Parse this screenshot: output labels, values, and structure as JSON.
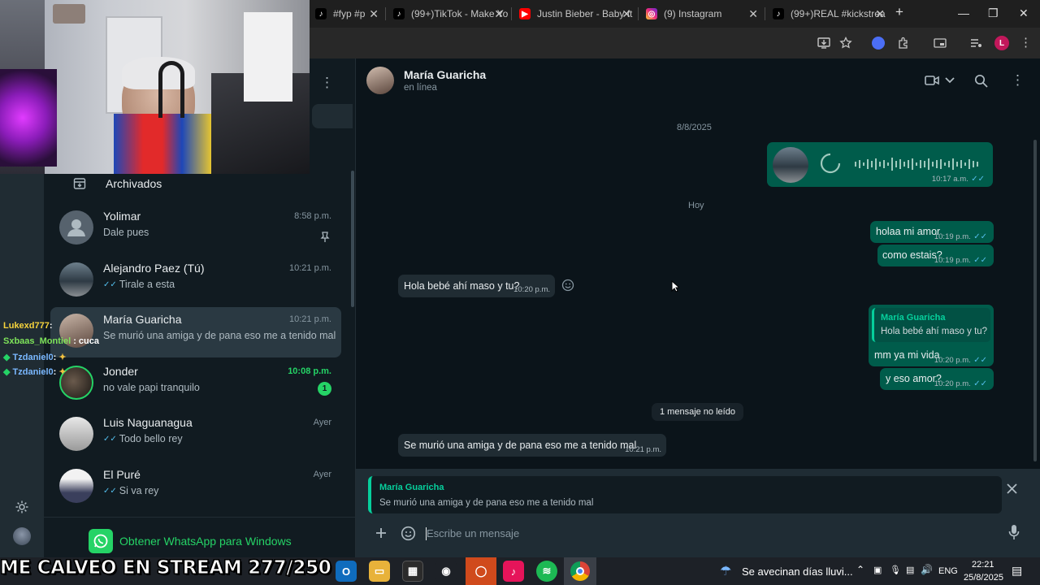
{
  "browser": {
    "tabs": [
      {
        "title": "#fyp #p",
        "icon": "tiktok-icon"
      },
      {
        "title": "(99+)TikTok - Make Yo",
        "icon": "tiktok-icon"
      },
      {
        "title": "Justin Bieber - Baby ft",
        "icon": "youtube-icon"
      },
      {
        "title": "(9) Instagram",
        "icon": "instagram-icon"
      },
      {
        "title": "(99+)REAL #kickstrea",
        "icon": "tiktok-icon"
      }
    ],
    "profile_initial": "L"
  },
  "sidebar": {
    "archived_label": "Archivados",
    "chats": [
      {
        "name": "Yolimar",
        "time": "8:58 p.m.",
        "preview": "Dale pues",
        "pinned": true
      },
      {
        "name": "Alejandro Paez (Tú)",
        "time": "10:21 p.m.",
        "preview": "Tirale a esta",
        "ticks": true
      },
      {
        "name": "María Guaricha",
        "time": "10:21 p.m.",
        "preview": "Se murió una amiga y de pana eso me a tenido mal"
      },
      {
        "name": "Jonder",
        "time": "10:08 p.m.",
        "preview": "no vale papi tranquilo",
        "unread": "1"
      },
      {
        "name": "Luis Naguanagua",
        "time": "Ayer",
        "preview": "Todo bello rey",
        "ticks": true
      },
      {
        "name": "El Puré",
        "time": "Ayer",
        "preview": "Si va rey",
        "ticks": true
      }
    ],
    "get_app_label": "Obtener WhatsApp para Windows"
  },
  "chat": {
    "contact_name": "María Guaricha",
    "status": "en línea",
    "date_chip_1": "8/8/2025",
    "date_chip_2": "Hoy",
    "unread_chip": "1 mensaje no leído",
    "messages": [
      {
        "dir": "out",
        "type": "audio",
        "time": "10:17 a.m."
      },
      {
        "dir": "out",
        "text": "holaa mi amor",
        "time": "10:19 p.m."
      },
      {
        "dir": "out",
        "text": "como estais?",
        "time": "10:19 p.m."
      },
      {
        "dir": "in",
        "text": "Hola bebé ahí maso y tu?",
        "time": "10:20 p.m."
      },
      {
        "dir": "out",
        "quoted_name": "María Guaricha",
        "quoted_text": "Hola bebé ahí maso y tu?",
        "text": "mm ya mi vida",
        "time": "10:20 p.m."
      },
      {
        "dir": "out",
        "text": "y eso amor?",
        "time": "10:20 p.m."
      },
      {
        "dir": "in",
        "text": "Se murió una amiga y de pana eso me a tenido mal",
        "time": "10:21 p.m."
      }
    ],
    "reply_preview": {
      "name": "María Guaricha",
      "text": "Se murió una amiga y de pana eso me a tenido mal"
    },
    "composer_placeholder": "Escribe un mensaje"
  },
  "stream_overlay": {
    "chat": [
      {
        "user": "Lukexd777",
        "sep": ":",
        "color": "#f6d33c"
      },
      {
        "user": "Sxbaas_Montiel",
        "sep": ": cuca",
        "color": "#7ee35a"
      },
      {
        "user": "Tzdaniel0",
        "sep": ":",
        "color": "#7ab8ff"
      },
      {
        "user": "Tzdaniel0",
        "sep": ":",
        "color": "#7ab8ff"
      }
    ],
    "title": "ME CALVEO EN STREAM 277/250"
  },
  "taskbar": {
    "weather": "Se avecinan días lluvi...",
    "lang": "ENG",
    "time": "22:21",
    "date": "25/8/2025"
  },
  "colors": {
    "accent": "#25d366",
    "bubble_out": "#005c4b",
    "bubble_in": "#202c33",
    "background": "#0b141a",
    "tick_blue": "#53bdeb"
  }
}
